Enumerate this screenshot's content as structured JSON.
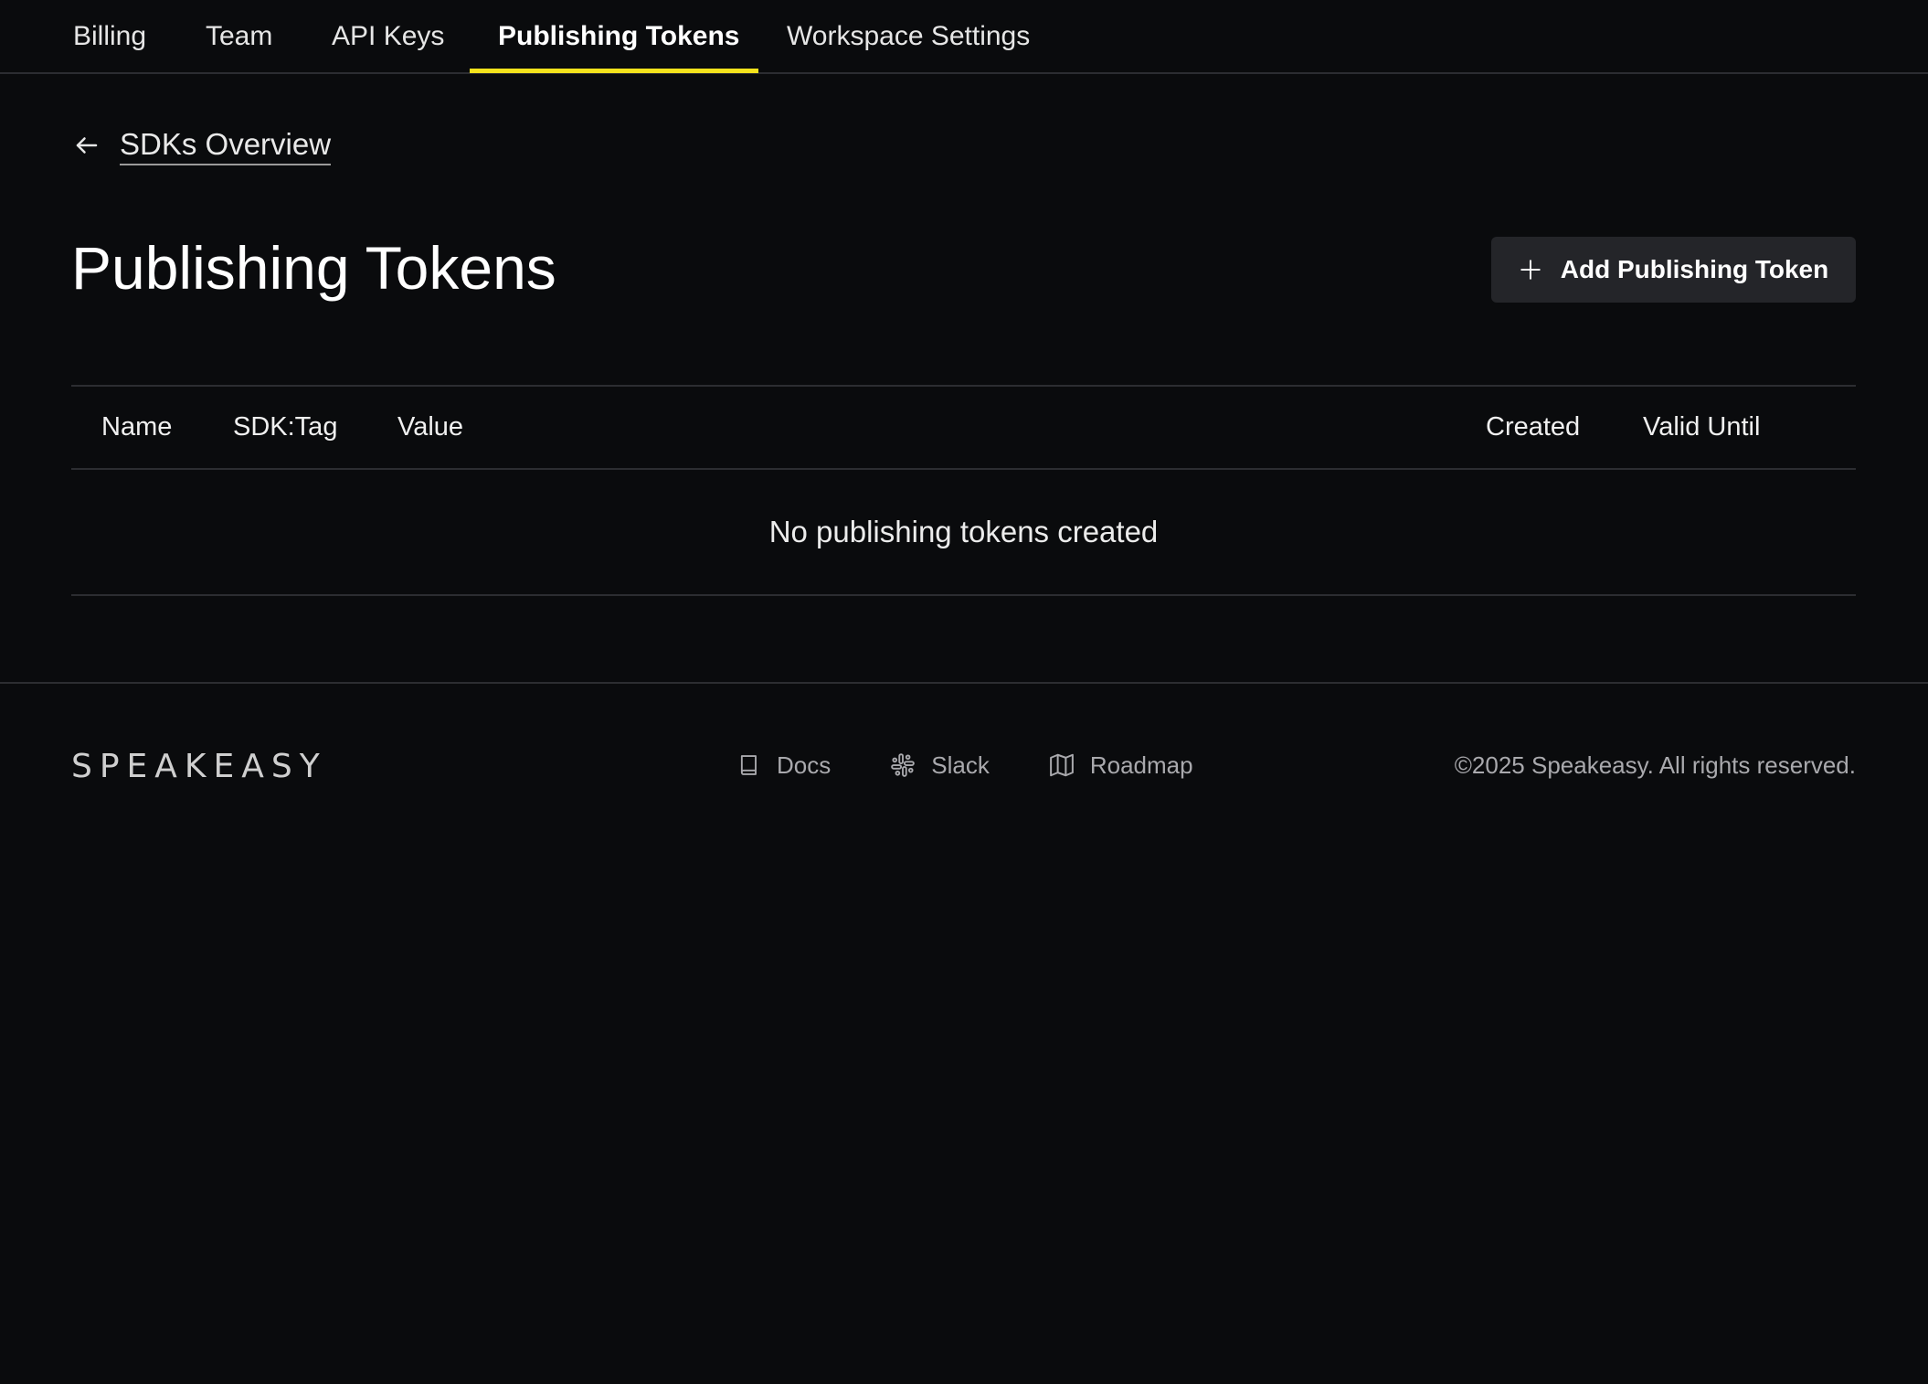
{
  "nav": {
    "tabs": [
      {
        "label": "Billing",
        "active": false
      },
      {
        "label": "Team",
        "active": false
      },
      {
        "label": "API Keys",
        "active": false
      },
      {
        "label": "Publishing Tokens",
        "active": true
      },
      {
        "label": "Workspace Settings",
        "active": false
      }
    ]
  },
  "back_link": {
    "label": "SDKs Overview",
    "icon": "arrow-left-icon"
  },
  "header": {
    "title": "Publishing Tokens",
    "add_button_label": "Add Publishing Token",
    "add_button_icon": "plus-icon"
  },
  "table": {
    "columns": [
      "Name",
      "SDK:Tag",
      "Value",
      "Created",
      "Valid Until"
    ],
    "rows": [],
    "empty_message": "No publishing tokens created"
  },
  "footer": {
    "logo": "SPEAKEASY",
    "links": [
      {
        "label": "Docs",
        "icon": "book-icon"
      },
      {
        "label": "Slack",
        "icon": "slack-icon"
      },
      {
        "label": "Roadmap",
        "icon": "map-icon"
      }
    ],
    "copyright": "©2025 Speakeasy. All rights reserved."
  },
  "colors": {
    "background": "#0a0b0d",
    "accent": "#f5e31c",
    "button_bg": "#242529",
    "divider": "#2c2d31"
  }
}
